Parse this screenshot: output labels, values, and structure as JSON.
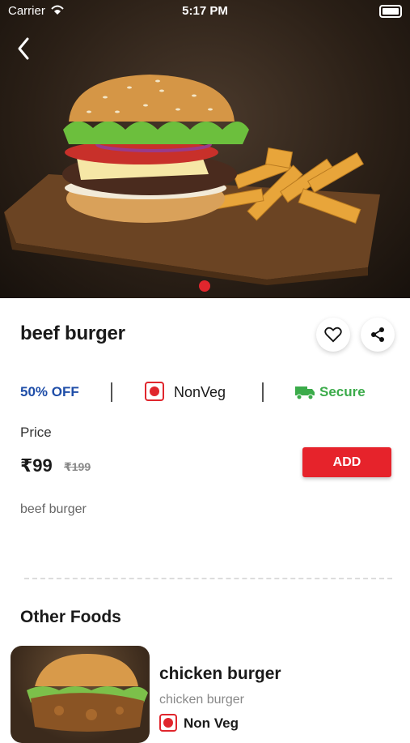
{
  "status_bar": {
    "carrier": "Carrier",
    "time": "5:17 PM"
  },
  "product": {
    "name": "beef burger",
    "discount": "50% OFF",
    "food_type": "NonVeg",
    "delivery": "Secure",
    "price_label": "Price",
    "price": "₹99",
    "mrp": "₹199",
    "add_label": "ADD",
    "description": "beef burger"
  },
  "other_foods": {
    "title": "Other Foods",
    "items": [
      {
        "name": "chicken burger",
        "description": "chicken burger",
        "food_type": "Non Veg"
      }
    ]
  },
  "colors": {
    "accent": "#e6232b",
    "discount": "#1f4ea8",
    "secure": "#3bab4a"
  },
  "icons": [
    "back-icon",
    "heart-icon",
    "share-icon",
    "nonveg-icon",
    "truck-icon",
    "wifi-icon",
    "battery-icon"
  ]
}
